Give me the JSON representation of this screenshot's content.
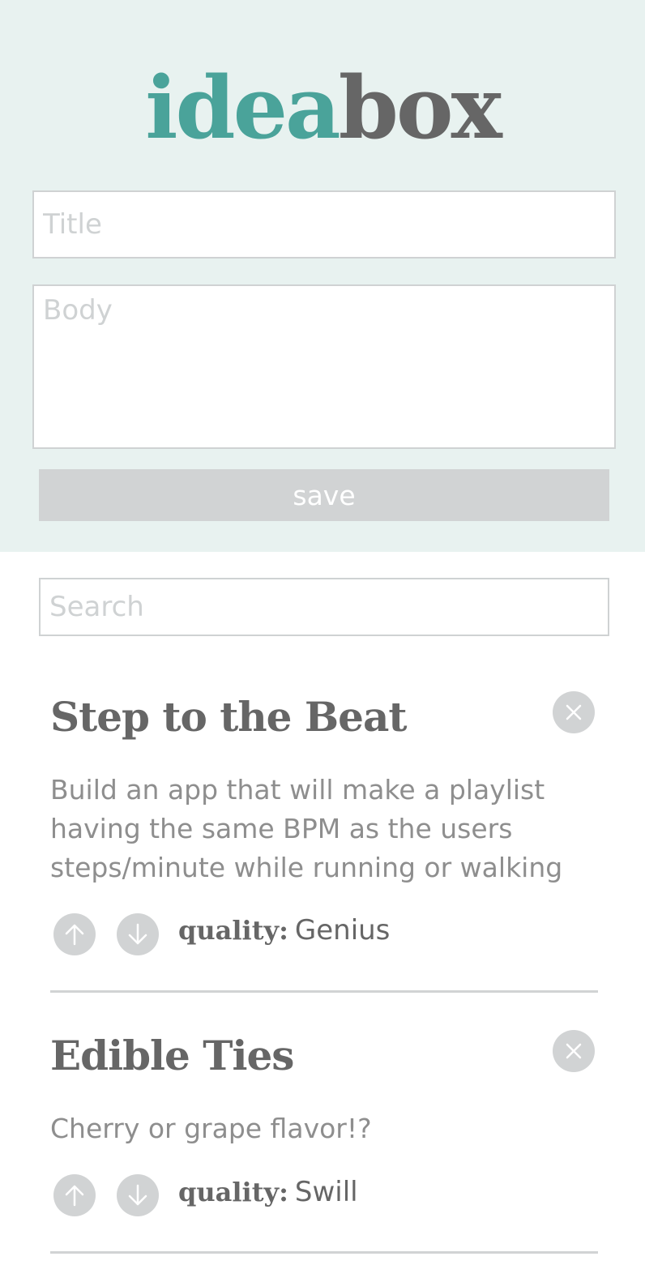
{
  "logo": {
    "part1": "idea",
    "part2": "box"
  },
  "form": {
    "title_placeholder": "Title",
    "title_value": "",
    "body_placeholder": "Body",
    "body_value": "",
    "save_label": "save"
  },
  "search": {
    "placeholder": "Search",
    "value": ""
  },
  "ideas": [
    {
      "title": "Step to the Beat",
      "body": "Build an app that will make a playlist having the same BPM as the users steps/minute while running or walking",
      "quality_label": "quality:",
      "quality": "Genius"
    },
    {
      "title": "Edible Ties",
      "body": "Cherry or grape flavor!?",
      "quality_label": "quality:",
      "quality": "Swill"
    }
  ],
  "icons": {
    "delete": "close-icon",
    "upvote": "arrow-up-icon",
    "downvote": "arrow-down-icon"
  },
  "colors": {
    "header_bg": "#e8f2f0",
    "brand_teal": "#4aa39a",
    "brand_gray": "#666666",
    "button_gray": "#d1d3d4",
    "placeholder": "#cfd2d3",
    "body_text": "#8e8e8e"
  }
}
